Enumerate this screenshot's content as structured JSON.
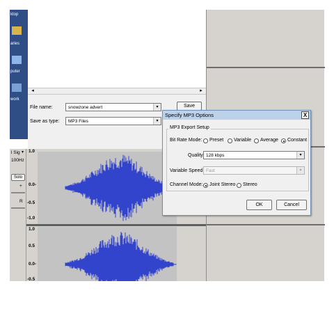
{
  "desktop": {
    "labels": [
      "ktop",
      "aries",
      "puter",
      "work"
    ]
  },
  "save_dialog": {
    "file_name_label": "File name:",
    "file_name_value": "snowzone advert",
    "save_as_label": "Save as type:",
    "save_as_value": "MP3 Files",
    "save_button": "Save"
  },
  "track": {
    "name": "l Sig",
    "rate": "100Hz",
    "solo": "Solo",
    "pan_right": "R",
    "plus": "+",
    "scale_top": "1.0",
    "scale_mid": "0.0-",
    "scale_low": "-0.5",
    "scale_bottom": "-1.0",
    "scale2_top": "1.0",
    "scale2_half": "0.5",
    "scale2_mid": "0.0-",
    "scale2_low": "-0.5"
  },
  "mp3_options": {
    "title": "Specify MP3 Options",
    "close": "X",
    "group_title": "MP3 Export Setup",
    "bit_rate_mode_label": "Bit Rate Mode:",
    "modes": [
      "Preset",
      "Variable",
      "Average",
      "Constant"
    ],
    "selected_mode": "Constant",
    "quality_label": "Quality",
    "quality_value": "128 kbps",
    "variable_speed_label": "Variable Speed:",
    "variable_speed_value": "Fast",
    "channel_mode_label": "Channel Mode:",
    "channel_modes": [
      "Joint Stereo",
      "Stereo"
    ],
    "selected_channel": "Joint Stereo",
    "ok": "OK",
    "cancel": "Cancel"
  },
  "colors": {
    "waveform": "#3344cc",
    "desktop": "#2f4e86",
    "dialog_title": "#bcd1ea"
  }
}
